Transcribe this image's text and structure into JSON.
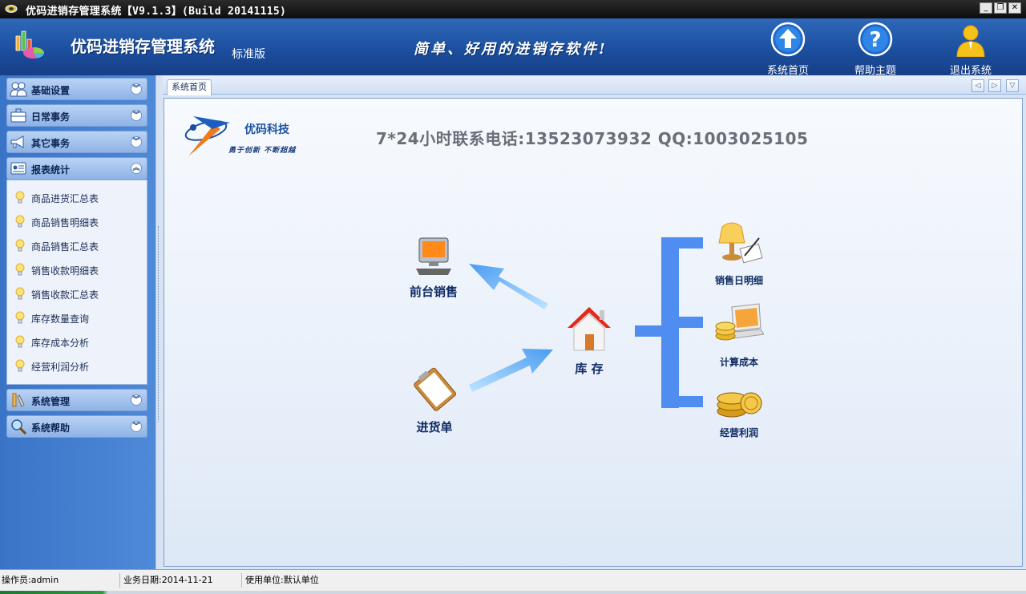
{
  "window": {
    "title": "优码进销存管理系统【V9.1.3】(Build 20141115)",
    "buttons": {
      "minimize": "_",
      "restore": "❐",
      "close": "✕"
    }
  },
  "header": {
    "brand": "优码进销存管理系统",
    "edition": "标准版",
    "slogan": "简单、好用的进销存软件!",
    "nav": [
      {
        "label": "系统首页",
        "icon": "home-arrow-icon"
      },
      {
        "label": "帮助主题",
        "icon": "help-icon"
      },
      {
        "label": "退出系统",
        "icon": "user-exit-icon"
      }
    ]
  },
  "sidebar": {
    "groups": [
      {
        "label": "基础设置",
        "icon": "users-icon",
        "expanded": false
      },
      {
        "label": "日常事务",
        "icon": "briefcase-icon",
        "expanded": false
      },
      {
        "label": "其它事务",
        "icon": "megaphone-icon",
        "expanded": false
      },
      {
        "label": "报表统计",
        "icon": "report-card-icon",
        "expanded": true
      },
      {
        "label": "系统管理",
        "icon": "tools-icon",
        "expanded": false
      },
      {
        "label": "系统帮助",
        "icon": "magnifier-icon",
        "expanded": false
      }
    ],
    "report_items": [
      "商品进货汇总表",
      "商品销售明细表",
      "商品销售汇总表",
      "销售收款明细表",
      "销售收款汇总表",
      "库存数量查询",
      "库存成本分析",
      "经营利润分析"
    ],
    "chevron_down": "︾",
    "chevron_up": "︽"
  },
  "tabs": {
    "active": "系统首页",
    "nav": {
      "prev": "◁",
      "next": "▷",
      "menu": "▽"
    }
  },
  "home": {
    "company": "优码科技",
    "motto": "勇于创新 不断超越",
    "contact": "7*24小时联系电话:13523073932   QQ:1003025105",
    "nodes": {
      "front_sales": "前台销售",
      "purchase_order": "进货单",
      "inventory": "库 存",
      "daily_sales": "销售日明细",
      "calc_cost": "计算成本",
      "profit": "经营利润"
    }
  },
  "status": {
    "operator": "操作员:admin",
    "date": "业务日期:2014-11-21",
    "unit": "使用单位:默认单位"
  },
  "colors": {
    "header_blue": "#1c4f9f",
    "flow_blue": "#4f8ef0",
    "arrow_light": "#78c8ff"
  }
}
